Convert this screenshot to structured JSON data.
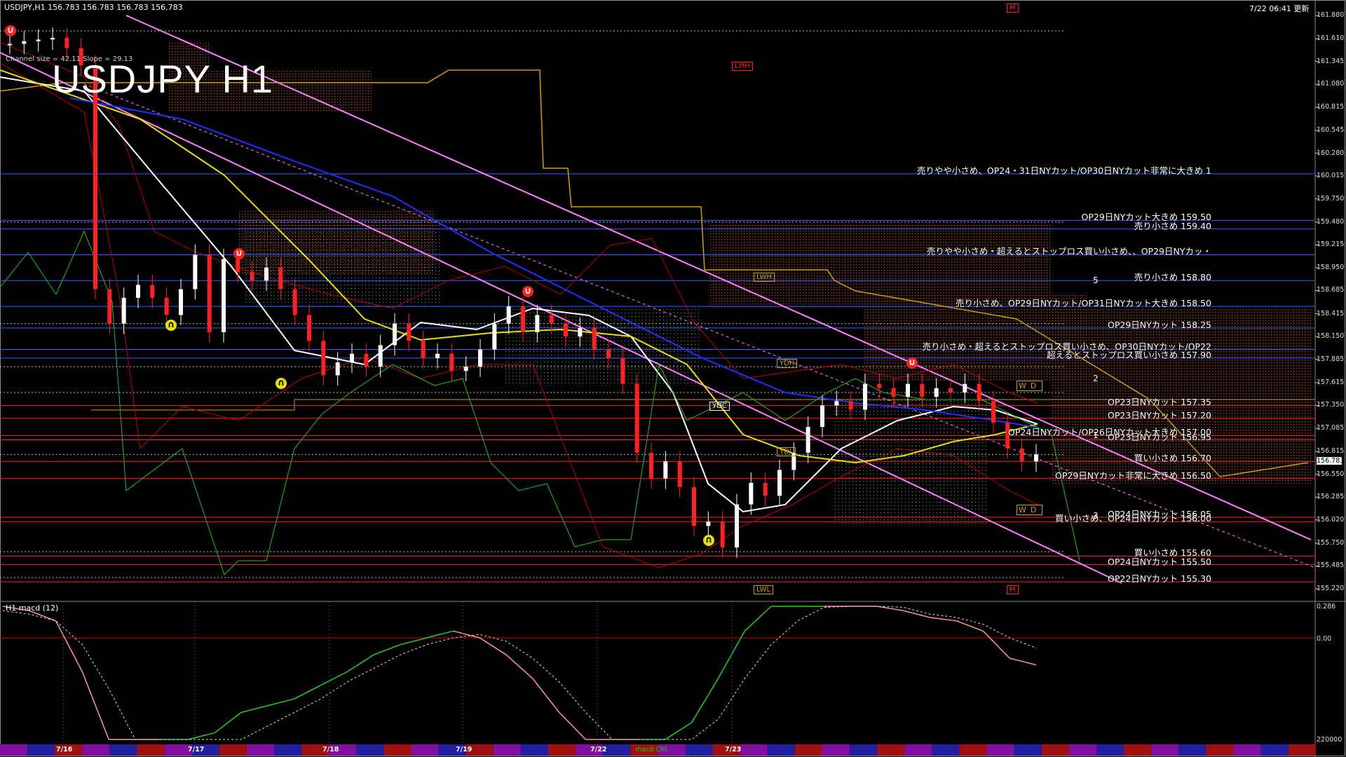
{
  "header": {
    "symbol_line": "USDJPY,H1  156.783 156.783 156.783 156.783",
    "big_title": "USDJPY H1",
    "channel_info": "Channel size = 42.11 Slope = 29.13",
    "updated": "7/22 06:41 更新",
    "m_marker": "M"
  },
  "price_axis": {
    "ticks": [
      "161.880",
      "161.610",
      "161.345",
      "161.080",
      "160.815",
      "160.545",
      "160.280",
      "160.015",
      "159.750",
      "159.480",
      "159.215",
      "158.950",
      "158.685",
      "158.415",
      "158.150",
      "157.885",
      "157.615",
      "157.350",
      "157.085",
      "156.815",
      "156.550",
      "156.285",
      "156.020",
      "155.750",
      "155.485",
      "155.220"
    ],
    "current": "156.783",
    "ymax": 161.88,
    "ymin": 155.22
  },
  "macd_axis": {
    "ticks": [
      "0.286",
      "0.00",
      "220000"
    ]
  },
  "annotations": [
    {
      "text": "売りやや小さめ、OP24・31日NYカット/OP30日NYカット非常に大きめ 1",
      "price": 160.04
    },
    {
      "text": "OP29日NYカット大きめ 159.50",
      "price": 159.5
    },
    {
      "text": "売り小さめ 159.40",
      "price": 159.4
    },
    {
      "text": "売りやや小さめ・超えるとストップロス買い小さめ、、OP29日NYカッ・",
      "price": 159.1
    },
    {
      "text": "売り小さめ 158.80",
      "price": 158.8
    },
    {
      "text": "売り小さめ、OP29日NYカット/OP31日NYカット大きめ 158.50",
      "price": 158.5
    },
    {
      "text": "OP29日NYカット 158.25",
      "price": 158.25
    },
    {
      "text": "売り小さめ・超えるとストップロス買い小さめ、OP30日NYカット/OP22",
      "price": 158.0
    },
    {
      "text": "超えるとストップロス買い小さめ 157.90",
      "price": 157.9
    },
    {
      "text": "OP23日NYカット 157.35",
      "price": 157.35
    },
    {
      "text": "OP23日NYカット 157.20",
      "price": 157.2
    },
    {
      "text": "OP24日NYカット/OP26日NYカット大きめ 157.00",
      "price": 157.0
    },
    {
      "text": "OP23日NYカット 156.95",
      "price": 156.95
    },
    {
      "text": "買い小さめ 156.70",
      "price": 156.7
    },
    {
      "text": "OP29日NYカット非常に大きめ 156.50",
      "price": 156.5
    },
    {
      "text": "OP24日NYカット 156.05",
      "price": 156.05
    },
    {
      "text": "買い小さめ、OP24日NYカット 156.00",
      "price": 156.0
    },
    {
      "text": "買い小さめ 155.60",
      "price": 155.6
    },
    {
      "text": "OP24日NYカット 155.50",
      "price": 155.5
    },
    {
      "text": "OP22日NYカット 155.30",
      "price": 155.3
    }
  ],
  "level_tags": [
    {
      "text": "LMH",
      "color": "#ff2020"
    },
    {
      "text": "LWH",
      "color": "#d0a000"
    },
    {
      "text": "YDH",
      "color": "#d0a000"
    },
    {
      "text": "YDC",
      "color": "#ffffff"
    },
    {
      "text": "YDL",
      "color": "#d0a000"
    },
    {
      "text": "LWL",
      "color": "#d0a000"
    },
    {
      "text": "M",
      "color": "#ff2020"
    }
  ],
  "wd_labels": [
    "WD",
    "WD"
  ],
  "wave_labels": [
    "5",
    "2",
    "1",
    "3"
  ],
  "dates": [
    "7/16",
    "7/17",
    "7/18",
    "7/19",
    "7/22",
    "7/23"
  ],
  "macd": {
    "label": "H1  macd (12)",
    "bottom_label": "macd Cht"
  },
  "colors": {
    "bull": "#ffffff",
    "bear": "#ff2020",
    "ma_fast": "#ffffff",
    "ma_mid": "#e8e000",
    "ma_slow": "#2030ff",
    "channel": "#ff80ff",
    "bollinger": "#c00000",
    "rsi": "#20c020",
    "support_line": "#3060ff",
    "resistance_line": "#ff2020",
    "cloud": "#ff5020"
  },
  "chart_data": {
    "type": "candlestick",
    "title": "USDJPY H1",
    "x_labels": [
      "7/16",
      "7/17",
      "7/18",
      "7/19",
      "7/22",
      "7/23"
    ],
    "ylim": [
      155.22,
      161.88
    ],
    "close_path": [
      161.55,
      161.58,
      161.6,
      161.62,
      161.5,
      161.3,
      158.7,
      158.3,
      158.6,
      158.75,
      158.6,
      158.4,
      158.7,
      159.1,
      158.2,
      159.05,
      158.9,
      158.8,
      158.95,
      158.7,
      158.4,
      158.1,
      157.7,
      157.85,
      157.95,
      157.8,
      158.05,
      158.3,
      158.1,
      157.9,
      157.95,
      157.75,
      157.8,
      158.0,
      158.3,
      158.5,
      158.2,
      158.4,
      158.3,
      158.15,
      158.25,
      158.0,
      157.9,
      157.6,
      156.8,
      156.5,
      156.7,
      156.4,
      155.95,
      156.0,
      155.7,
      156.2,
      156.45,
      156.3,
      156.6,
      156.8,
      157.1,
      157.35,
      157.4,
      157.3,
      157.6,
      157.55,
      157.45,
      157.6,
      157.45,
      157.55,
      157.5,
      157.6,
      157.4,
      157.15,
      156.85,
      156.7,
      156.78
    ],
    "macd_line": [
      0.1,
      0.08,
      0.05,
      -0.1,
      -0.3,
      -0.45,
      -0.46,
      -0.35,
      -0.28,
      -0.22,
      -0.2,
      -0.18,
      -0.14,
      -0.1,
      -0.05,
      -0.02,
      0.0,
      0.02,
      0.0,
      -0.05,
      -0.12,
      -0.22,
      -0.32,
      -0.38,
      -0.4,
      -0.35,
      -0.25,
      -0.12,
      0.02,
      0.1,
      0.13,
      0.14,
      0.12,
      0.1,
      0.08,
      0.06,
      0.05,
      0.02,
      -0.06,
      -0.08
    ],
    "signal_line": [
      0.08,
      0.07,
      0.05,
      -0.02,
      -0.15,
      -0.3,
      -0.4,
      -0.4,
      -0.36,
      -0.3,
      -0.26,
      -0.22,
      -0.18,
      -0.13,
      -0.09,
      -0.05,
      -0.02,
      0.0,
      0.01,
      -0.01,
      -0.06,
      -0.13,
      -0.22,
      -0.3,
      -0.35,
      -0.36,
      -0.32,
      -0.24,
      -0.12,
      -0.02,
      0.05,
      0.09,
      0.11,
      0.1,
      0.09,
      0.07,
      0.06,
      0.04,
      0.0,
      -0.03
    ]
  }
}
